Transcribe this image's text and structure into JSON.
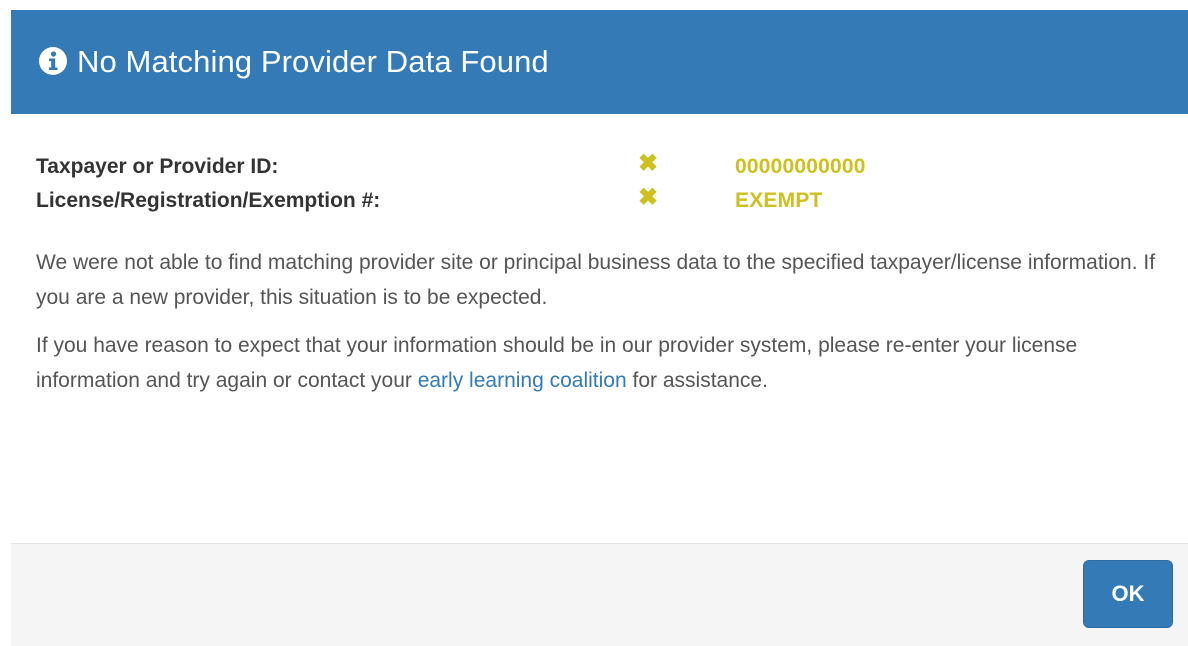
{
  "dialog": {
    "title": "No Matching Provider Data Found",
    "header_color": "#337ab7",
    "icon": "info-circle-icon"
  },
  "fields": [
    {
      "label": "Taxpayer or Provider ID:",
      "status_icon": "x-mark-icon",
      "value": "00000000000"
    },
    {
      "label": "License/Registration/Exemption #:",
      "status_icon": "x-mark-icon",
      "value": "EXEMPT"
    }
  ],
  "status_color": "#ccc11e",
  "messages": {
    "para1": "We were not able to find matching provider site or principal business data to the specified taxpayer/license information. If you are a new provider, this situation is to be expected.",
    "para2_before": "If you have reason to expect that your information should be in our provider system, please re-enter your license information and try again or contact your ",
    "para2_link": "early learning coalition",
    "para2_after": " for assistance."
  },
  "footer": {
    "ok_label": "OK"
  }
}
